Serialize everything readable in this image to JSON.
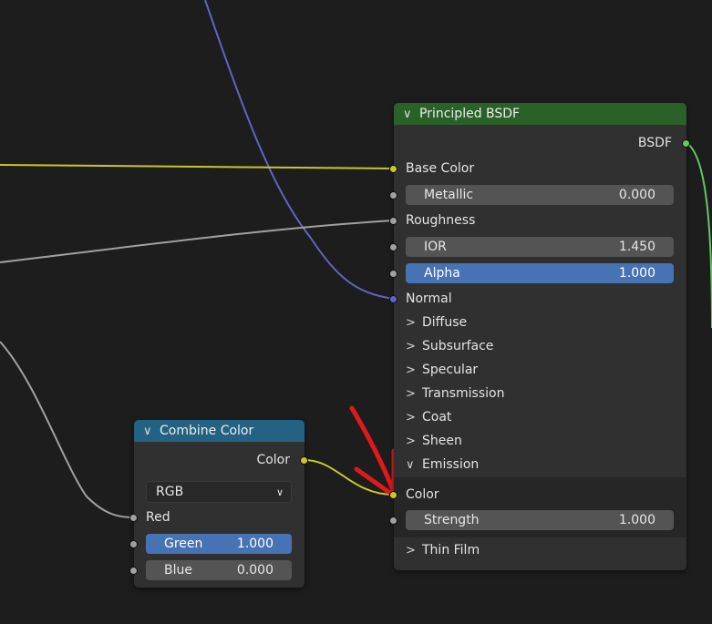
{
  "principled": {
    "title": "Principled BSDF",
    "header_color": "#2a6129",
    "output": "BSDF",
    "inputs": {
      "base_color": "Base Color",
      "roughness": "Roughness",
      "normal": "Normal",
      "emission_color": "Color"
    },
    "fields": {
      "metallic": {
        "label": "Metallic",
        "value": "0.000"
      },
      "ior": {
        "label": "IOR",
        "value": "1.450"
      },
      "alpha": {
        "label": "Alpha",
        "value": "1.000"
      },
      "strength": {
        "label": "Strength",
        "value": "1.000"
      }
    },
    "panels": {
      "diffuse": "Diffuse",
      "subsurface": "Subsurface",
      "specular": "Specular",
      "transmission": "Transmission",
      "coat": "Coat",
      "sheen": "Sheen",
      "emission": "Emission",
      "thin_film": "Thin Film"
    }
  },
  "combine": {
    "title": "Combine Color",
    "header_color": "#246283",
    "output": "Color",
    "mode": "RGB",
    "inputs": {
      "red": "Red"
    },
    "fields": {
      "green": {
        "label": "Green",
        "value": "1.000"
      },
      "blue": {
        "label": "Blue",
        "value": "0.000"
      }
    }
  },
  "colors": {
    "wire_yellow": "#c7c729",
    "wire_gray": "#a1a1a1",
    "wire_blue": "#6363c7",
    "wire_green": "#63c763",
    "annotation_red": "#e01a1a"
  }
}
